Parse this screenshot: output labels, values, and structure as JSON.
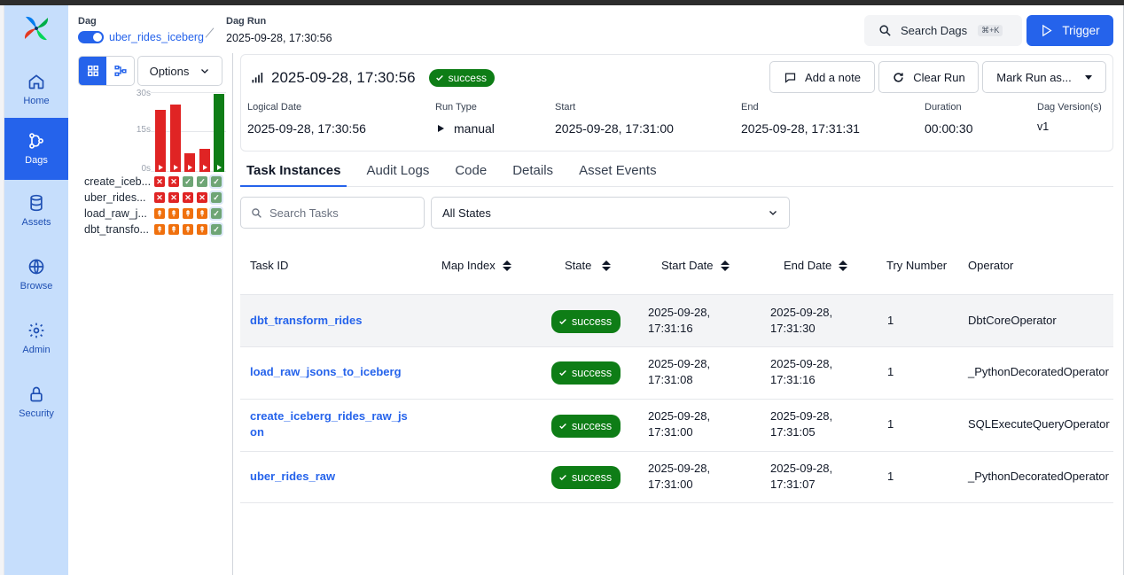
{
  "nav": {
    "items": [
      {
        "label": "Home",
        "icon": "home-icon"
      },
      {
        "label": "Dags",
        "icon": "dags-icon"
      },
      {
        "label": "Assets",
        "icon": "database-icon"
      },
      {
        "label": "Browse",
        "icon": "globe-icon"
      },
      {
        "label": "Admin",
        "icon": "gear-icon"
      },
      {
        "label": "Security",
        "icon": "lock-icon"
      }
    ]
  },
  "breadcrumb": {
    "dag_label": "Dag",
    "dag_name": "uber_rides_iceberg",
    "run_label": "Dag Run",
    "run_value": "2025-09-28, 17:30:56"
  },
  "header": {
    "search_label": "Search Dags",
    "search_shortcut": "⌘+K",
    "trigger_label": "Trigger"
  },
  "grid": {
    "options_label": "Options",
    "ticks": [
      "30s",
      "15s",
      "0s"
    ],
    "durations": [
      {
        "seconds": 24,
        "state": "failed"
      },
      {
        "seconds": 26,
        "state": "failed"
      },
      {
        "seconds": 7,
        "state": "failed"
      },
      {
        "seconds": 9,
        "state": "failed"
      },
      {
        "seconds": 30,
        "state": "success"
      }
    ],
    "tasks": [
      {
        "name": "create_iceb...",
        "states": [
          "failed",
          "failed",
          "success",
          "success",
          "success"
        ]
      },
      {
        "name": "uber_rides...",
        "states": [
          "failed",
          "failed",
          "failed",
          "failed",
          "success"
        ]
      },
      {
        "name": "load_raw_j...",
        "states": [
          "upstream",
          "upstream",
          "upstream",
          "upstream",
          "success"
        ]
      },
      {
        "name": "dbt_transfo...",
        "states": [
          "upstream",
          "upstream",
          "upstream",
          "upstream",
          "success"
        ]
      }
    ]
  },
  "run": {
    "title": "2025-09-28, 17:30:56",
    "state": "success",
    "add_note_label": "Add a note",
    "clear_run_label": "Clear Run",
    "mark_run_label": "Mark Run as...",
    "fields": {
      "logical_date": {
        "label": "Logical Date",
        "value": "2025-09-28, 17:30:56"
      },
      "run_type": {
        "label": "Run Type",
        "value": "manual"
      },
      "start": {
        "label": "Start",
        "value": "2025-09-28, 17:31:00"
      },
      "end": {
        "label": "End",
        "value": "2025-09-28, 17:31:31"
      },
      "duration": {
        "label": "Duration",
        "value": "00:00:30"
      },
      "version": {
        "label": "Dag Version(s)",
        "value": "v1"
      }
    }
  },
  "tabs": [
    "Task Instances",
    "Audit Logs",
    "Code",
    "Details",
    "Asset Events"
  ],
  "filters": {
    "search_placeholder": "Search Tasks",
    "state_selected": "All States"
  },
  "table": {
    "columns": [
      "Task ID",
      "Map Index",
      "State",
      "Start Date",
      "End Date",
      "Try Number",
      "Operator"
    ],
    "rows": [
      {
        "task_id": "dbt_transform_rides",
        "state": "success",
        "start_date": "2025-09-28,",
        "start_time": "17:31:16",
        "end_date": "2025-09-28,",
        "end_time": "17:31:30",
        "try_number": "1",
        "operator": "DbtCoreOperator"
      },
      {
        "task_id": "load_raw_jsons_to_iceberg",
        "state": "success",
        "start_date": "2025-09-28,",
        "start_time": "17:31:08",
        "end_date": "2025-09-28,",
        "end_time": "17:31:16",
        "try_number": "1",
        "operator": "_PythonDecoratedOperator"
      },
      {
        "task_id": "create_iceberg_rides_raw_json",
        "state": "success",
        "start_date": "2025-09-28,",
        "start_time": "17:31:00",
        "end_date": "2025-09-28,",
        "end_time": "17:31:05",
        "try_number": "1",
        "operator": "SQLExecuteQueryOperator"
      },
      {
        "task_id": "uber_rides_raw",
        "state": "success",
        "start_date": "2025-09-28,",
        "start_time": "17:31:00",
        "end_date": "2025-09-28,",
        "end_time": "17:31:07",
        "try_number": "1",
        "operator": "_PythonDecoratedOperator"
      }
    ]
  },
  "colors": {
    "accent": "#2563eb",
    "success": "#0e7d16",
    "failed": "#e02424",
    "upstream_failed": "#f0700d",
    "nav_bg": "#c6defc"
  }
}
